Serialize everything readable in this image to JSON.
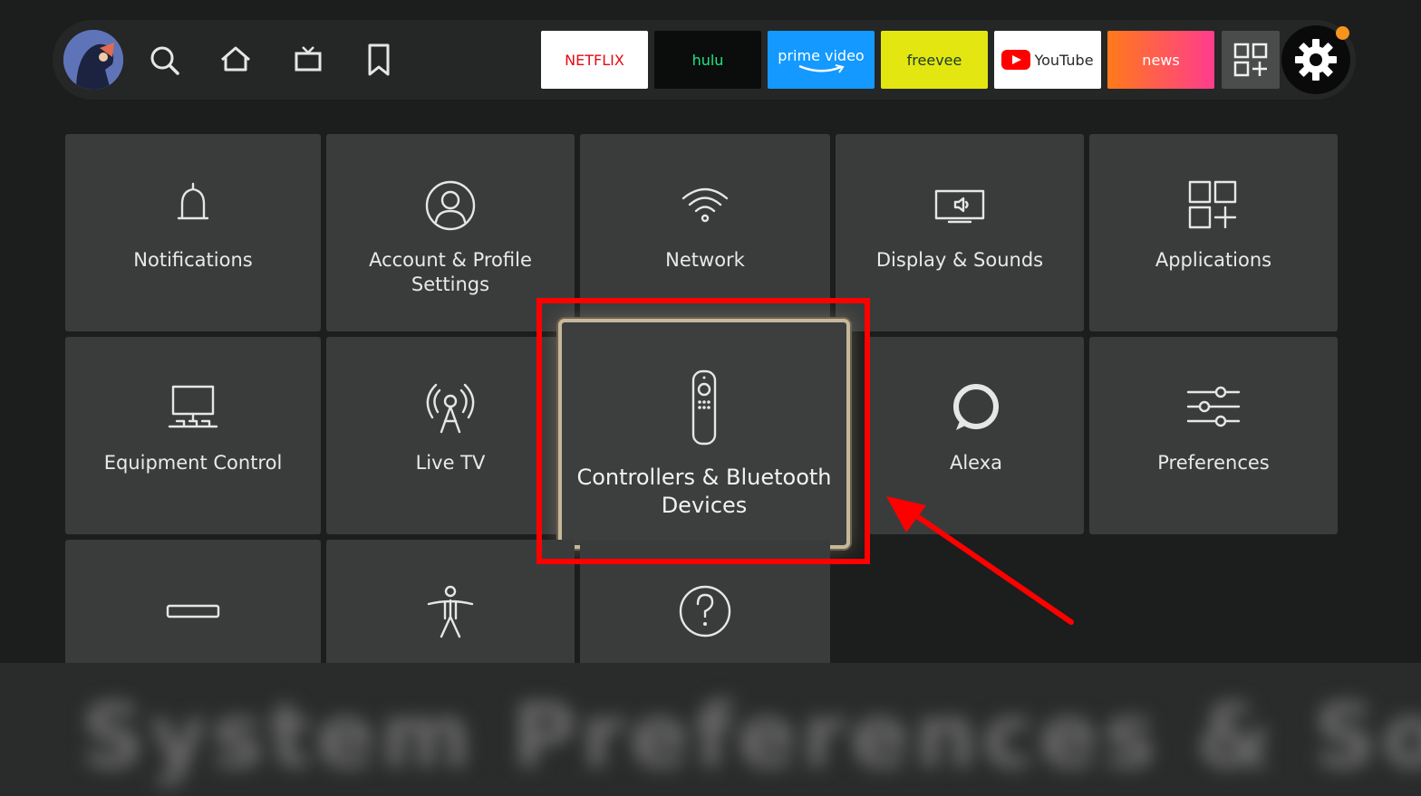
{
  "navbar": {
    "apps": [
      {
        "label": "NETFLIX",
        "bg": "#ffffff",
        "color": "#e50914"
      },
      {
        "label": "hulu",
        "bg": "#0b0c0c",
        "color": "#1ce783"
      },
      {
        "label": "prime video",
        "bg": "#1399ff",
        "color": "#ffffff"
      },
      {
        "label": "freevee",
        "bg": "#e3e611",
        "color": "#1a3b2a"
      },
      {
        "label": "YouTube",
        "bg": "#ffffff",
        "color": "#282828"
      },
      {
        "label": "news",
        "bg": "#ff6a2b",
        "color": "#ffffff"
      }
    ],
    "notification_dot_color": "#f7941d"
  },
  "settings": {
    "tiles": [
      {
        "label": "Notifications",
        "icon": "bell-icon"
      },
      {
        "label": "Account & Profile Settings",
        "icon": "profile-icon"
      },
      {
        "label": "Network",
        "icon": "wifi-icon"
      },
      {
        "label": "Display & Sounds",
        "icon": "display-sound-icon"
      },
      {
        "label": "Applications",
        "icon": "apps-grid-icon"
      },
      {
        "label": "Equipment Control",
        "icon": "equipment-icon"
      },
      {
        "label": "Live TV",
        "icon": "antenna-icon"
      },
      {
        "label": "Controllers & Bluetooth Devices",
        "icon": "remote-icon"
      },
      {
        "label": "Alexa",
        "icon": "alexa-icon"
      },
      {
        "label": "Preferences",
        "icon": "sliders-icon"
      },
      {
        "label": "",
        "icon": "firetv-device-icon"
      },
      {
        "label": "",
        "icon": "accessibility-icon"
      },
      {
        "label": "",
        "icon": "help-icon"
      }
    ],
    "focused_index": 7
  },
  "annotation": {
    "color": "#ff0000"
  },
  "bottom_caption": "System Preferences & Sound"
}
